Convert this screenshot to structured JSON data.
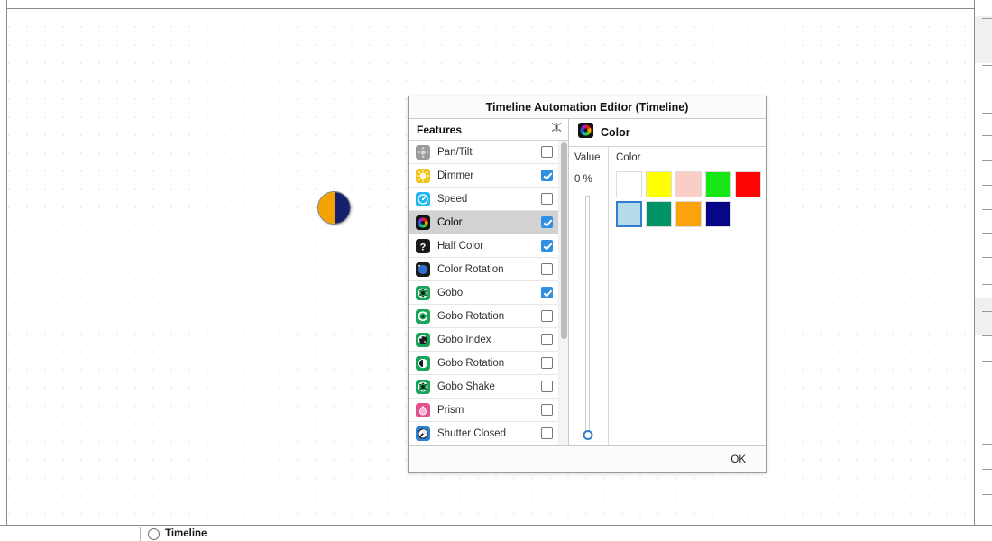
{
  "app": {
    "canvas_background": "#ffffff",
    "grid_dot_color": "#c8c8c8"
  },
  "fixture": {
    "name": "moving-head-fixture",
    "left_half_color": "#f5a300",
    "right_half_color": "#14206e"
  },
  "bottom_strip": {
    "timeline_label": "Timeline"
  },
  "dialog": {
    "title": "Timeline Automation Editor (Timeline)",
    "ok_label": "OK",
    "features_pane": {
      "header_label": "Features",
      "header_icon": "collapse-all-icon",
      "items": [
        {
          "label": "Pan/Tilt",
          "icon": "pan-tilt-icon",
          "checked": false,
          "selected": false,
          "icon_color": "#8a8a8a"
        },
        {
          "label": "Dimmer",
          "icon": "dimmer-icon",
          "checked": true,
          "selected": false,
          "icon_color": "#f2c314"
        },
        {
          "label": "Speed",
          "icon": "speed-icon",
          "checked": false,
          "selected": false,
          "icon_color": "#22b7ef"
        },
        {
          "label": "Color",
          "icon": "color-wheel-icon",
          "checked": true,
          "selected": true,
          "icon_color": "#1a1a1a"
        },
        {
          "label": "Half Color",
          "icon": "half-color-icon",
          "checked": true,
          "selected": false,
          "icon_color": "#1a1a1a"
        },
        {
          "label": "Color Rotation",
          "icon": "color-rotation-icon",
          "checked": false,
          "selected": false,
          "icon_color": "#1a1a1a"
        },
        {
          "label": "Gobo",
          "icon": "gobo-icon",
          "checked": true,
          "selected": false,
          "icon_color": "#18a55a"
        },
        {
          "label": "Gobo Rotation",
          "icon": "gobo-rotation-icon",
          "checked": false,
          "selected": false,
          "icon_color": "#18a55a"
        },
        {
          "label": "Gobo Index",
          "icon": "gobo-index-icon",
          "checked": false,
          "selected": false,
          "icon_color": "#18a55a"
        },
        {
          "label": "Gobo Rotation",
          "icon": "gobo-rotation2-icon",
          "checked": false,
          "selected": false,
          "icon_color": "#18a55a"
        },
        {
          "label": "Gobo Shake",
          "icon": "gobo-shake-icon",
          "checked": false,
          "selected": false,
          "icon_color": "#18a55a"
        },
        {
          "label": "Prism",
          "icon": "prism-icon",
          "checked": false,
          "selected": false,
          "icon_color": "#e2508f"
        },
        {
          "label": "Shutter Closed",
          "icon": "shutter-closed-icon",
          "checked": false,
          "selected": false,
          "icon_color": "#2f7fd0"
        }
      ]
    },
    "detail_pane": {
      "title": "Color",
      "title_icon": "color-wheel-icon",
      "value_label": "Value",
      "value_text": "0 %",
      "value_percent": 0,
      "color_label": "Color",
      "swatches": [
        {
          "name": "white",
          "hex": "#ffffff",
          "selected": false
        },
        {
          "name": "yellow",
          "hex": "#ffff00",
          "selected": false
        },
        {
          "name": "pink",
          "hex": "#fbcdc7",
          "selected": false
        },
        {
          "name": "green",
          "hex": "#16e516",
          "selected": false
        },
        {
          "name": "red",
          "hex": "#fb0505",
          "selected": false
        },
        {
          "name": "light-blue",
          "hex": "#b4dbe8",
          "selected": true
        },
        {
          "name": "teal",
          "hex": "#019365",
          "selected": false
        },
        {
          "name": "orange",
          "hex": "#fba30d",
          "selected": false
        },
        {
          "name": "navy",
          "hex": "#060687",
          "selected": false
        }
      ]
    }
  }
}
